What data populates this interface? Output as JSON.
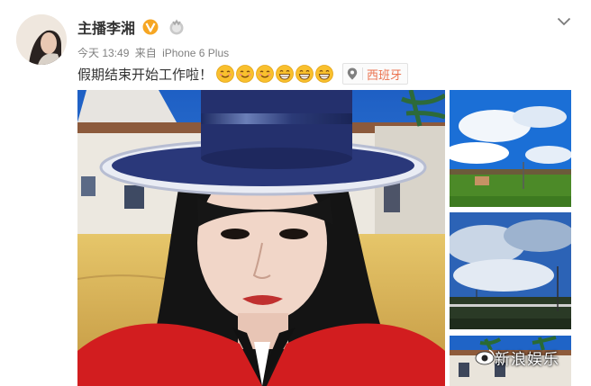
{
  "post": {
    "author": "主播李湘",
    "meta": {
      "time": "今天 13:49",
      "source_prefix": "来自",
      "source": "iPhone 6 Plus"
    },
    "text": "假期结束开始工作啦！",
    "emoji_count": 6,
    "location": "西班牙",
    "watermark": "新浪娱乐"
  },
  "icons": {
    "vip": "vip-v-icon",
    "badge": "member-badge-icon",
    "menu": "chevron-down-icon",
    "location": "location-pin-icon",
    "emoji": [
      "smile-emoji",
      "smile-emoji",
      "smile-emoji",
      "grin-emoji",
      "grin-emoji",
      "grin-emoji"
    ]
  },
  "colors": {
    "accent": "#eb7350",
    "vip": "#f6a623",
    "text": "#333333",
    "meta": "#808080"
  }
}
